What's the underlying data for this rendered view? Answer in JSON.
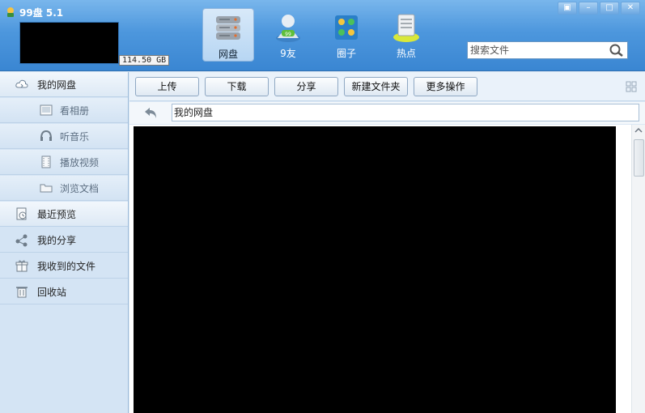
{
  "app": {
    "title": "99盘 5.1",
    "quota": "114.50 GB"
  },
  "nav_tabs": [
    {
      "label": "网盘",
      "icon": "server-icon",
      "active": true
    },
    {
      "label": "9友",
      "icon": "friend-icon",
      "active": false
    },
    {
      "label": "圈子",
      "icon": "group-icon",
      "active": false
    },
    {
      "label": "热点",
      "icon": "hot-icon",
      "active": false
    }
  ],
  "window_controls": [
    "pin-icon",
    "minimize-icon",
    "maximize-icon",
    "close-icon"
  ],
  "search": {
    "placeholder": "搜索文件",
    "value": ""
  },
  "sidebar": {
    "items": [
      {
        "label": "我的网盘",
        "icon": "cloud-icon",
        "sub": false,
        "selected": true
      },
      {
        "label": "看相册",
        "icon": "photo-icon",
        "sub": true
      },
      {
        "label": "听音乐",
        "icon": "headphone-icon",
        "sub": true
      },
      {
        "label": "播放视频",
        "icon": "film-icon",
        "sub": true
      },
      {
        "label": "浏览文档",
        "icon": "folder-icon",
        "sub": true
      },
      {
        "label": "最近预览",
        "icon": "recent-icon",
        "sub": false
      },
      {
        "label": "我的分享",
        "icon": "share-icon",
        "sub": false
      },
      {
        "label": "我收到的文件",
        "icon": "gift-icon",
        "sub": false
      },
      {
        "label": "回收站",
        "icon": "trash-icon",
        "sub": false
      }
    ]
  },
  "toolbar": {
    "buttons": [
      "上传",
      "下载",
      "分享",
      "新建文件夹",
      "更多操作"
    ]
  },
  "path": {
    "current": "我的网盘"
  },
  "colors": {
    "header": "#4d97dd",
    "sidebar": "#d4e4f4",
    "accent": "#3a86d2"
  }
}
